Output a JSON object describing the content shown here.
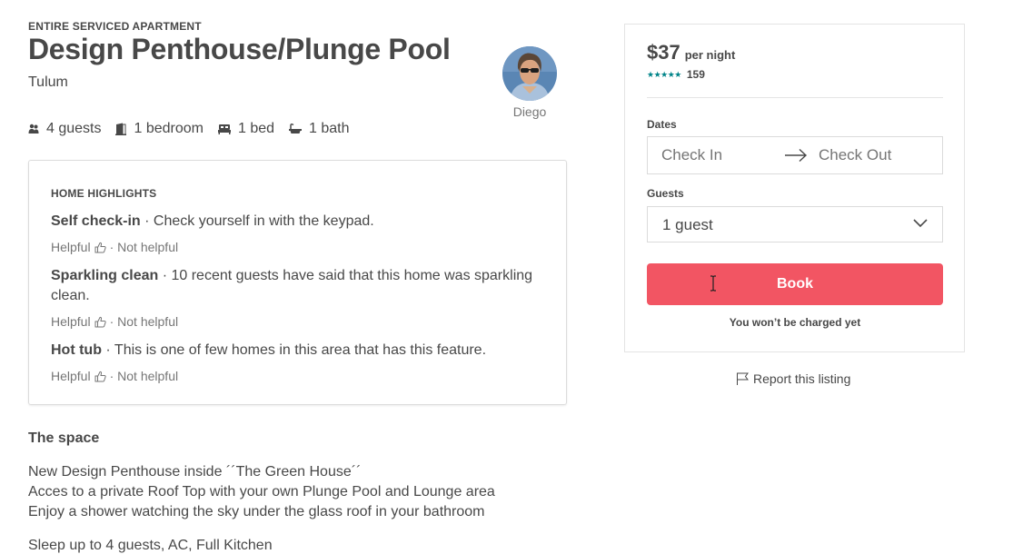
{
  "listing": {
    "type": "ENTIRE SERVICED APARTMENT",
    "title": "Design Penthouse/Plunge Pool",
    "city": "Tulum"
  },
  "host": {
    "name": "Diego"
  },
  "amenities": [
    {
      "icon": "guests-icon",
      "label": "4 guests"
    },
    {
      "icon": "bedroom-icon",
      "label": "1 bedroom"
    },
    {
      "icon": "bed-icon",
      "label": "1 bed"
    },
    {
      "icon": "bath-icon",
      "label": "1 bath"
    }
  ],
  "highlights": {
    "title": "HOME HIGHLIGHTS",
    "helpful_label": "Helpful",
    "separator": "·",
    "not_helpful_label": "Not helpful",
    "items": [
      {
        "name": "Self check-in",
        "text": " · Check yourself in with the keypad."
      },
      {
        "name": "Sparkling clean",
        "text": " · 10 recent guests have said that this home was sparkling clean."
      },
      {
        "name": "Hot tub",
        "text": " · This is one of few homes in this area that has this feature."
      }
    ]
  },
  "space": {
    "title": "The space",
    "lines": [
      "New Design Penthouse inside ´´The Green House´´",
      "Acces to a private Roof Top with your own Plunge Pool and Lounge area",
      "Enjoy a shower watching the sky under the glass roof in your bathroom",
      "Sleep up to 4 guests, AC, Full Kitchen"
    ]
  },
  "booking": {
    "price": "$37",
    "price_unit": "per night",
    "stars": "★★★★★",
    "rating": 4.5,
    "review_count": "159",
    "dates_label": "Dates",
    "check_in_placeholder": "Check In",
    "check_out_placeholder": "Check Out",
    "guests_label": "Guests",
    "guests_value": "1 guest",
    "book_label": "Book",
    "not_charged": "You won’t be charged yet"
  },
  "report": {
    "label": "Report this listing"
  },
  "colors": {
    "text": "#484848",
    "muted": "#767676",
    "accent": "#f25563",
    "stars": "#008489"
  }
}
